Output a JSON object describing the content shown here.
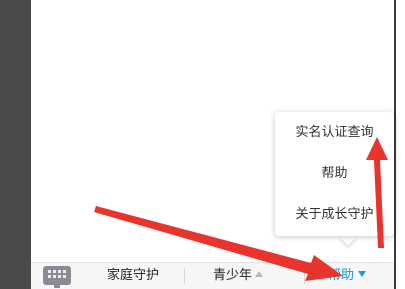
{
  "tabbar": {
    "tabs": [
      {
        "label": "家庭守护"
      },
      {
        "label": "青少年"
      },
      {
        "label": "帮助"
      }
    ]
  },
  "help_menu": {
    "items": [
      {
        "label": "实名认证查询"
      },
      {
        "label": "帮助"
      },
      {
        "label": "关于成长守护"
      }
    ]
  },
  "icons": {
    "keyboard": "keyboard-icon",
    "youth_caret": "triangle-up-icon",
    "help_caret": "triangle-down-icon"
  },
  "colors": {
    "accent": "#1a9ad8",
    "annotation_arrow": "#e8342c",
    "side_frame": "#4a4a4a"
  }
}
